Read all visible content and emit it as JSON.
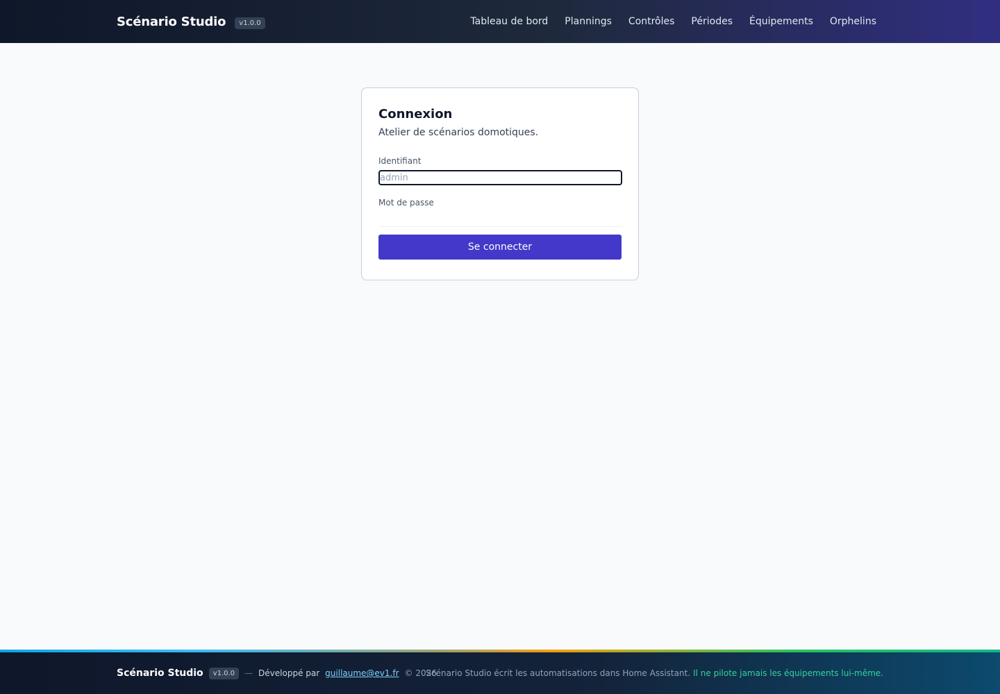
{
  "header": {
    "brand": "Scénario Studio",
    "version": "v1.0.0",
    "nav": [
      {
        "label": "Tableau de bord"
      },
      {
        "label": "Plannings"
      },
      {
        "label": "Contrôles"
      },
      {
        "label": "Périodes"
      },
      {
        "label": "Équipements"
      },
      {
        "label": "Orphelins"
      }
    ]
  },
  "login": {
    "title": "Connexion",
    "subtitle": "Atelier de scénarios domotiques.",
    "username_label": "Identifiant",
    "username_placeholder": "admin",
    "username_value": "",
    "password_label": "Mot de passe",
    "password_value": "",
    "submit_label": "Se connecter"
  },
  "footer": {
    "brand": "Scénario Studio",
    "version": "v1.0.0",
    "separator": "—",
    "developed_by": "Développé par",
    "author_email": "guillaume@ev1.fr",
    "copyright": "© 2026",
    "notice": "Scénario Studio écrit les automatisations dans Home Assistant.",
    "notice_highlight": "Il ne pilote jamais les équipements lui-même."
  },
  "colors": {
    "primary": "#4338ca",
    "header_bg": "#0f172a",
    "accent_link": "#7dd3fc",
    "accent_green": "#34d399"
  }
}
